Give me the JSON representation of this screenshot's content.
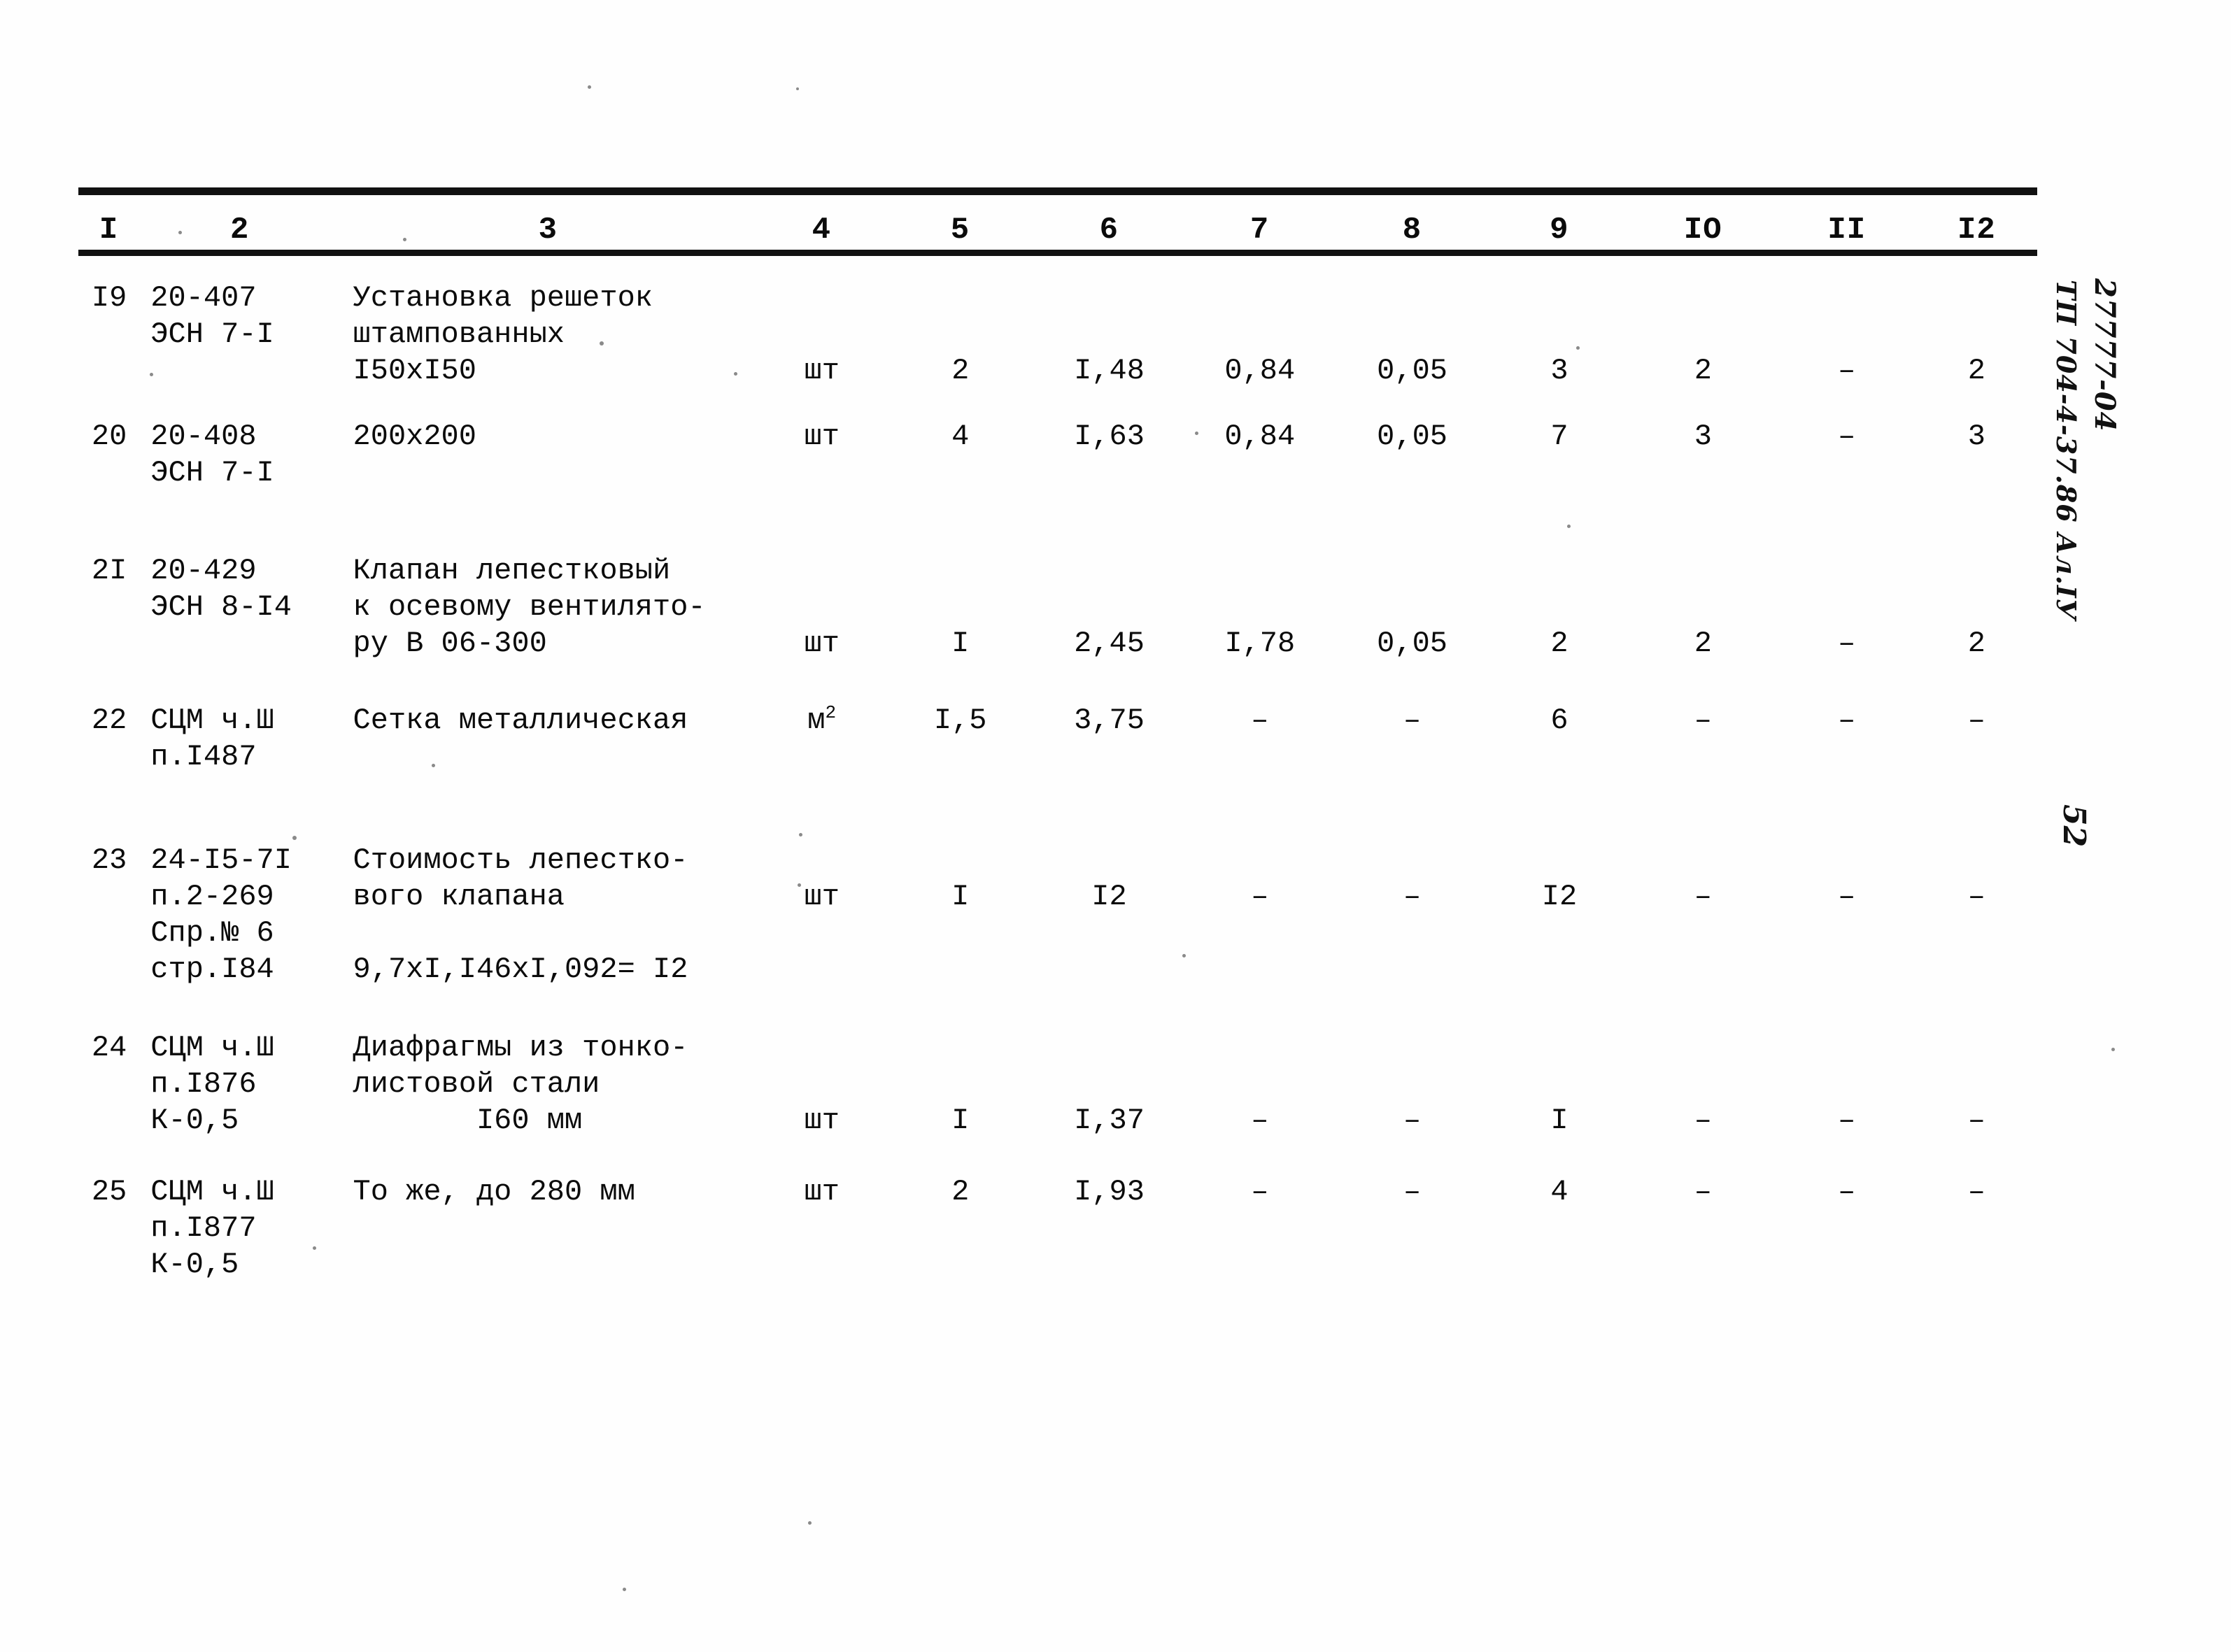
{
  "document": {
    "type": "estimate-table",
    "page_number": "52"
  },
  "table": {
    "column_headers": [
      "I",
      "2",
      "3",
      "4",
      "5",
      "6",
      "7",
      "8",
      "9",
      "IO",
      "II",
      "I2"
    ],
    "rows": [
      {
        "no": "I9",
        "code_lines": [
          "20-407",
          "ЭСН 7-I"
        ],
        "description_lines": [
          "Установка решеток",
          "штампованных",
          "I50xI50"
        ],
        "unit": "шт",
        "values": [
          "2",
          "I,48",
          "0,84",
          "0,05",
          "3",
          "2",
          "–",
          "2"
        ],
        "value_line": 2
      },
      {
        "no": "20",
        "code_lines": [
          "20-408",
          "ЭСН 7-I"
        ],
        "description_lines": [
          "200x200"
        ],
        "unit": "шт",
        "values": [
          "4",
          "I,63",
          "0,84",
          "0,05",
          "7",
          "3",
          "–",
          "3"
        ],
        "value_line": 0
      },
      {
        "no": "2I",
        "code_lines": [
          "20-429",
          "ЭСН 8-I4"
        ],
        "description_lines": [
          "Клапан лепестковый",
          "к осевому вентилято-",
          "ру В 06-300"
        ],
        "unit": "шт",
        "values": [
          "I",
          "2,45",
          "I,78",
          "0,05",
          "2",
          "2",
          "–",
          "2"
        ],
        "value_line": 2
      },
      {
        "no": "22",
        "code_lines": [
          "СЦМ ч.Ш",
          "п.I487"
        ],
        "description_lines": [
          "Сетка металлическая"
        ],
        "unit": "м",
        "unit_superscript": "2",
        "values": [
          "I,5",
          "3,75",
          "–",
          "–",
          "6",
          "–",
          "–",
          "–"
        ],
        "value_line": 0
      },
      {
        "no": "23",
        "code_lines": [
          "24-I5-7I",
          "п.2-269",
          "Спр.№ 6",
          "стр.I84"
        ],
        "description_lines": [
          "Стоимость лепестко-",
          "вого клапана",
          "",
          "9,7xI,I46xI,092= I2"
        ],
        "unit": "шт",
        "values": [
          "I",
          "I2",
          "–",
          "–",
          "I2",
          "–",
          "–",
          "–"
        ],
        "value_line": 1
      },
      {
        "no": "24",
        "code_lines": [
          "СЦМ ч.Ш",
          "п.I876",
          "К-0,5"
        ],
        "description_lines": [
          "Диафрагмы из тонко-",
          "листовой стали",
          "       I60 мм"
        ],
        "unit": "шт",
        "values": [
          "I",
          "I,37",
          "–",
          "–",
          "I",
          "–",
          "–",
          "–"
        ],
        "value_line": 2
      },
      {
        "no": "25",
        "code_lines": [
          "СЦМ ч.Ш",
          "п.I877",
          "К-0,5"
        ],
        "description_lines": [
          "То же, до 280 мм"
        ],
        "unit": "шт",
        "values": [
          "2",
          "I,93",
          "–",
          "–",
          "4",
          "–",
          "–",
          "–"
        ],
        "value_line": 0
      }
    ]
  },
  "margin_notes": {
    "doc_code": "27777-04",
    "series_code": "ТП 704-4-37.86 Ал.IУ",
    "page_number": "52"
  }
}
